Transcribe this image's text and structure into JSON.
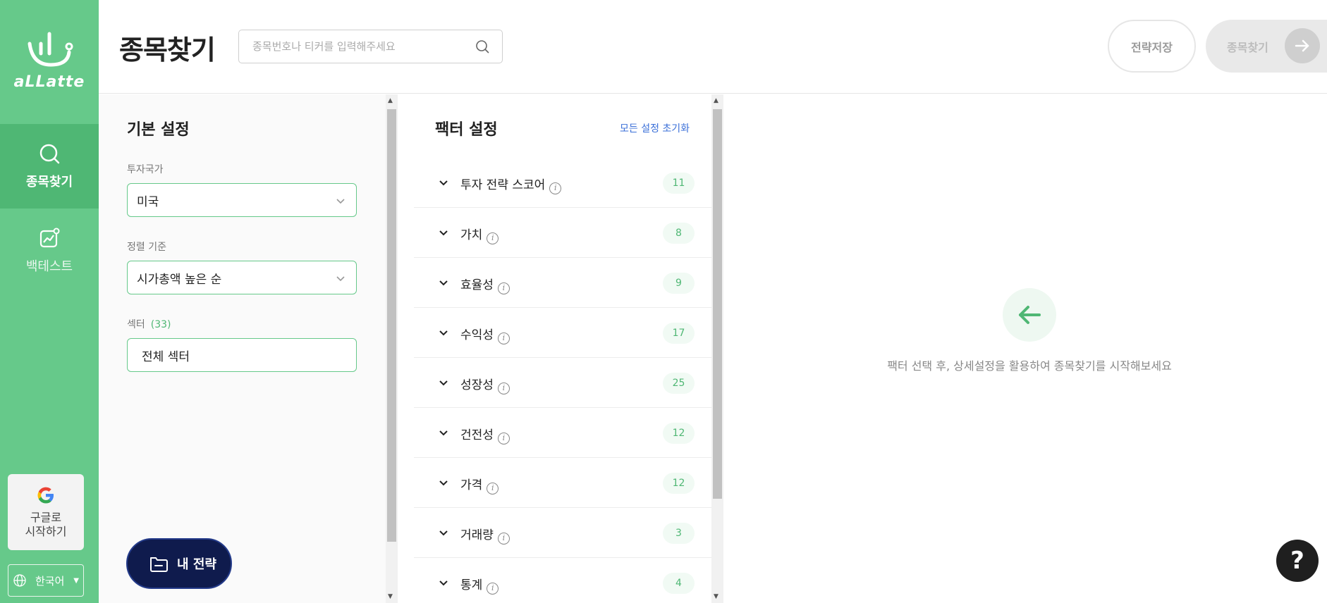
{
  "sidebar": {
    "logo_text": "aLLatte",
    "nav": [
      {
        "label": "종목찾기",
        "icon": "search-icon",
        "active": true
      },
      {
        "label": "백테스트",
        "icon": "chart-icon",
        "active": false
      }
    ],
    "google_label": "구글로\n시작하기",
    "language": "한국어"
  },
  "header": {
    "title": "종목찾기",
    "search_placeholder": "종목번호나 티커를 입력해주세요",
    "save_button": "전략저장",
    "find_button": "종목찾기"
  },
  "basic": {
    "heading": "기본 설정",
    "country_label": "투자국가",
    "country_value": "미국",
    "sort_label": "정렬 기준",
    "sort_value": "시가총액 높은 순",
    "sector_label": "섹터",
    "sector_count": "(33)",
    "sector_value": "전체 섹터",
    "my_strategy": "내 전략"
  },
  "factors": {
    "heading": "팩터 설정",
    "reset": "모든 설정 초기화",
    "items": [
      {
        "name": "투자 전략 스코어",
        "count": "11"
      },
      {
        "name": "가치",
        "count": "8"
      },
      {
        "name": "효율성",
        "count": "9"
      },
      {
        "name": "수익성",
        "count": "17"
      },
      {
        "name": "성장성",
        "count": "25"
      },
      {
        "name": "건전성",
        "count": "12"
      },
      {
        "name": "가격",
        "count": "12"
      },
      {
        "name": "거래량",
        "count": "3"
      },
      {
        "name": "통계",
        "count": "4"
      }
    ]
  },
  "empty_state": {
    "message": "팩터 선택 후, 상세설정을 활용하여 종목찾기를 시작해보세요"
  },
  "help": "?",
  "colors": {
    "brand_green": "#66c98a",
    "active_green": "#4fb774",
    "navy": "#0f1b4d",
    "link_blue": "#3a6fd8"
  }
}
